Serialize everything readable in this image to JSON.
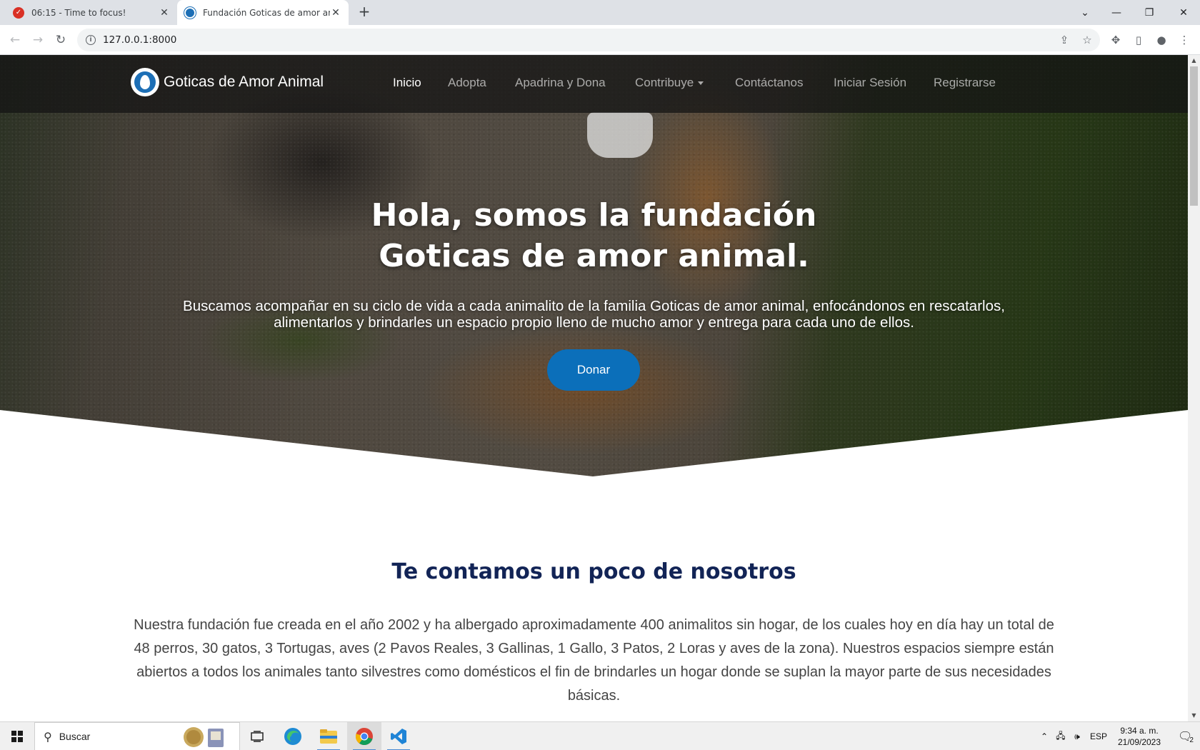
{
  "browser": {
    "tabs": [
      {
        "title": "06:15 - Time to focus!",
        "active": false,
        "favicon": "check-circle-icon"
      },
      {
        "title": "Fundación Goticas de amor anim",
        "active": true,
        "favicon": "goticas-logo-icon"
      }
    ],
    "url": "127.0.0.1:8000"
  },
  "site": {
    "brand": "Goticas de Amor Animal",
    "nav": [
      {
        "label": "Inicio",
        "active": true
      },
      {
        "label": "Adopta",
        "active": false
      },
      {
        "label": "Apadrina y Dona",
        "active": false
      },
      {
        "label": "Contribuye",
        "active": false,
        "dropdown": true
      },
      {
        "label": "Contáctanos",
        "active": false
      },
      {
        "label": "Iniciar Sesión",
        "active": false
      },
      {
        "label": "Registrarse",
        "active": false
      }
    ],
    "hero": {
      "title_line1": "Hola, somos la fundación",
      "title_line2": "Goticas de amor animal.",
      "subtitle": "Buscamos acompañar en su ciclo de vida a cada animalito de la familia Goticas de amor animal, enfocándonos en rescatarlos, alimentarlos y brindarles un espacio propio lleno de mucho amor y entrega para cada uno de ellos.",
      "cta": "Donar"
    },
    "about": {
      "title": "Te contamos un poco de nosotros",
      "text": "Nuestra fundación fue creada en el año 2002 y ha albergado aproximadamente 400 animalitos sin hogar, de los cuales hoy en día hay un total de 48 perros, 30 gatos, 3 Tortugas, aves (2 Pavos Reales, 3 Gallinas, 1 Gallo, 3 Patos, 2 Loras y aves de la zona). Nuestros espacios siempre están abiertos a todos los animales tanto silvestres como domésticos el fin de brindarles un hogar donde se suplan la mayor parte de sus necesidades básicas."
    }
  },
  "taskbar": {
    "search_placeholder": "Buscar",
    "language": "ESP",
    "time": "9:34 a. m.",
    "date": "21/09/2023",
    "notifications": "2"
  },
  "colors": {
    "brand_blue": "#0b6fba",
    "heading_navy": "#122456"
  }
}
